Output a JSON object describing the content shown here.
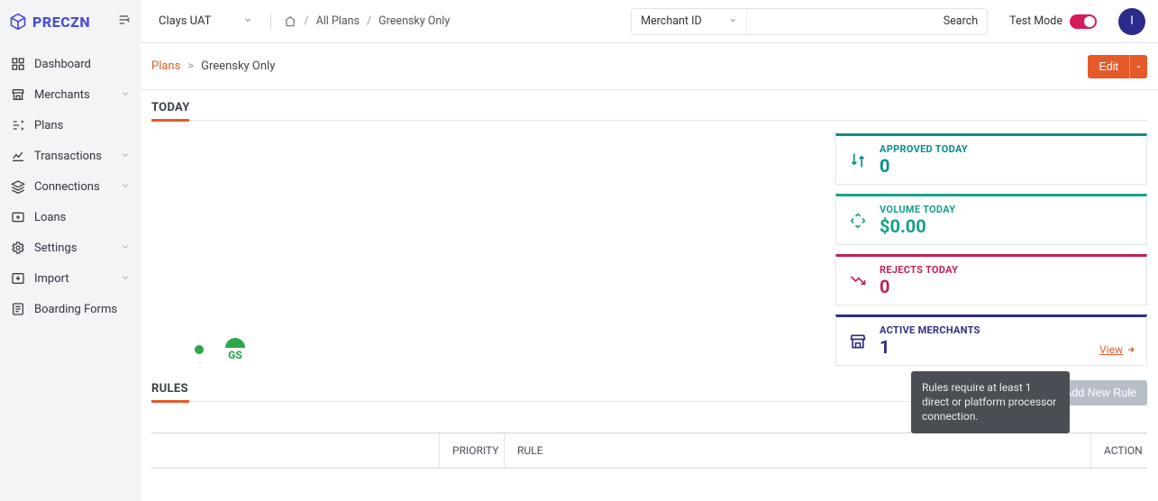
{
  "brand": "PRECZN",
  "env": {
    "selected": "Clays UAT"
  },
  "topCrumbs": {
    "allPlans": "All Plans",
    "current": "Greensky Only"
  },
  "search": {
    "criteriaLabel": "Merchant ID",
    "placeholder": "",
    "button": "Search"
  },
  "testMode": {
    "label": "Test Mode",
    "on": true
  },
  "avatar": {
    "initial": "I"
  },
  "sidebar": {
    "items": [
      {
        "label": "Dashboard",
        "expandable": false
      },
      {
        "label": "Merchants",
        "expandable": true
      },
      {
        "label": "Plans",
        "expandable": false
      },
      {
        "label": "Transactions",
        "expandable": true
      },
      {
        "label": "Connections",
        "expandable": true
      },
      {
        "label": "Loans",
        "expandable": false
      },
      {
        "label": "Settings",
        "expandable": true
      },
      {
        "label": "Import",
        "expandable": true
      },
      {
        "label": "Boarding Forms",
        "expandable": false
      }
    ]
  },
  "page": {
    "breadcrumb": {
      "link": "Plans",
      "current": "Greensky Only"
    },
    "editLabel": "Edit"
  },
  "today": {
    "title": "TODAY",
    "legendBadge": "GS",
    "cards": {
      "approved": {
        "label": "APPROVED TODAY",
        "value": "0"
      },
      "volume": {
        "label": "VOLUME TODAY",
        "value": "$0.00"
      },
      "rejects": {
        "label": "REJECTS TODAY",
        "value": "0"
      },
      "merchants": {
        "label": "ACTIVE MERCHANTS",
        "value": "1",
        "viewLabel": "View"
      }
    }
  },
  "rules": {
    "title": "RULES",
    "addLabel": "Add New Rule",
    "tooltip": "Rules require at least 1 direct or platform processor connection.",
    "columns": {
      "priority": "PRIORITY",
      "rule": "RULE",
      "action": "ACTION"
    }
  }
}
